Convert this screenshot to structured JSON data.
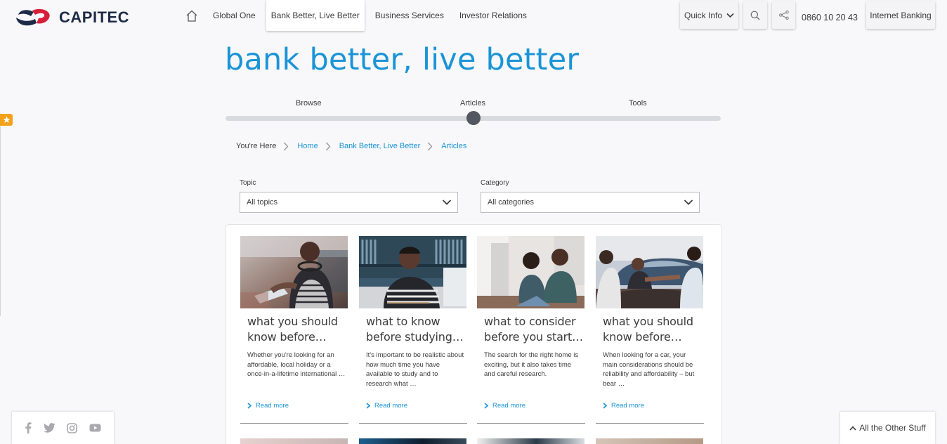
{
  "header": {
    "logo_text": "CAPITEC",
    "nav": [
      {
        "label": "Global One"
      },
      {
        "label": "Bank Better, Live Better"
      },
      {
        "label": "Business Services"
      },
      {
        "label": "Investor Relations"
      }
    ],
    "quick_info": "Quick Info",
    "phone": "0860 10 20 43",
    "internet_banking": "Internet Banking"
  },
  "page": {
    "title": "bank better, live better",
    "slider": {
      "labels": [
        "Browse",
        "Articles",
        "Tools"
      ],
      "selected_index": 1
    }
  },
  "breadcrumb": {
    "prefix": "You're Here",
    "items": [
      "Home",
      "Bank Better, Live Better",
      "Articles"
    ]
  },
  "filters": {
    "topic": {
      "label": "Topic",
      "value": "All topics"
    },
    "category": {
      "label": "Category",
      "value": "All categories"
    }
  },
  "articles": [
    {
      "title": "what you should know before…",
      "excerpt": "Whether you're looking for an affordable, local holiday or a once-in-a-lifetime international …",
      "more": "Read more"
    },
    {
      "title": "what to know before studying…",
      "excerpt": "It's important to be realistic about how much time you have available to study and to research what …",
      "more": "Read more"
    },
    {
      "title": "what to consider before you start…",
      "excerpt": "The search for the right home is exciting, but it also takes time and careful research.",
      "more": "Read more"
    },
    {
      "title": "what you should know before…",
      "excerpt": "When looking for a car, your main considerations should be reliability and affordability – but bear …",
      "more": "Read more"
    }
  ],
  "footer": {
    "other_stuff": "All the Other Stuff"
  },
  "colors": {
    "accent": "#1a94d6",
    "brand_navy": "#1e2b47",
    "brand_red": "#d71f3c",
    "badge": "#f4a11a"
  }
}
